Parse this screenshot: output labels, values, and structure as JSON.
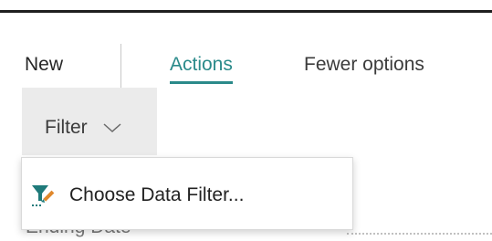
{
  "action_bar": {
    "new_label": "New",
    "actions_label": "Actions",
    "fewer_options_label": "Fewer options"
  },
  "filter": {
    "label": "Filter"
  },
  "dropdown": {
    "items": [
      {
        "label": "Choose Data Filter...",
        "icon": "filter-pencil-icon"
      }
    ]
  },
  "fields": {
    "ending_date_label": "Ending Date"
  },
  "colors": {
    "accent": "#2a8a8a",
    "filter_bg": "#ebebeb",
    "icon_teal": "#1f7a7a",
    "icon_orange": "#e0882c"
  }
}
